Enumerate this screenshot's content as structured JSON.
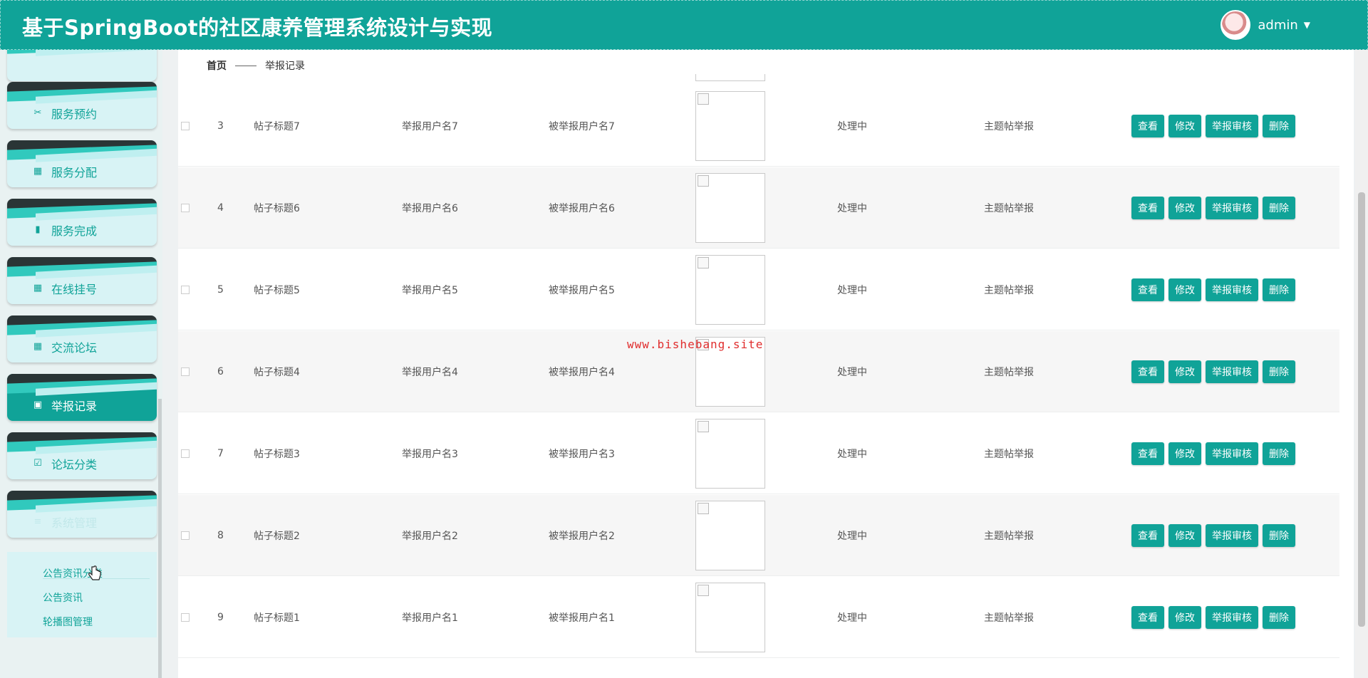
{
  "app": {
    "title": "基于SpringBoot的社区康养管理系统设计与实现",
    "user": "admin"
  },
  "sidebar": {
    "items": [
      {
        "label": "服务预约",
        "icon": "scissors-icon"
      },
      {
        "label": "服务分配",
        "icon": "grid-icon"
      },
      {
        "label": "服务完成",
        "icon": "bar-chart-icon"
      },
      {
        "label": "在线挂号",
        "icon": "grid-icon"
      },
      {
        "label": "交流论坛",
        "icon": "grid-icon"
      },
      {
        "label": "举报记录",
        "icon": "clipboard-icon",
        "active": true
      },
      {
        "label": "论坛分类",
        "icon": "check-square-icon"
      },
      {
        "label": "系统管理",
        "icon": "list-icon"
      }
    ],
    "sub_items": [
      "公告资讯分类",
      "公告资讯",
      "轮播图管理"
    ]
  },
  "breadcrumb": {
    "home": "首页",
    "current": "举报记录"
  },
  "table": {
    "rows": [
      {
        "index": "3",
        "title": "帖子标题7",
        "reporter": "举报用户名7",
        "reported": "被举报用户名7",
        "status": "处理中",
        "type": "主题帖举报"
      },
      {
        "index": "4",
        "title": "帖子标题6",
        "reporter": "举报用户名6",
        "reported": "被举报用户名6",
        "status": "处理中",
        "type": "主题帖举报"
      },
      {
        "index": "5",
        "title": "帖子标题5",
        "reporter": "举报用户名5",
        "reported": "被举报用户名5",
        "status": "处理中",
        "type": "主题帖举报"
      },
      {
        "index": "6",
        "title": "帖子标题4",
        "reporter": "举报用户名4",
        "reported": "被举报用户名4",
        "status": "处理中",
        "type": "主题帖举报"
      },
      {
        "index": "7",
        "title": "帖子标题3",
        "reporter": "举报用户名3",
        "reported": "被举报用户名3",
        "status": "处理中",
        "type": "主题帖举报"
      },
      {
        "index": "8",
        "title": "帖子标题2",
        "reporter": "举报用户名2",
        "reported": "被举报用户名2",
        "status": "处理中",
        "type": "主题帖举报"
      },
      {
        "index": "9",
        "title": "帖子标题1",
        "reporter": "举报用户名1",
        "reported": "被举报用户名1",
        "status": "处理中",
        "type": "主题帖举报"
      }
    ],
    "actions": {
      "view": "查看",
      "edit": "修改",
      "review": "举报审核",
      "delete": "删除"
    }
  },
  "watermark": "www.bishebang.site",
  "colors": {
    "primary": "#10a398",
    "dark_band": "#2a3536"
  }
}
